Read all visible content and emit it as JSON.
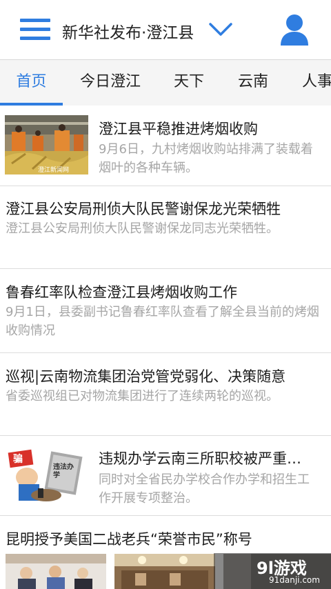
{
  "header": {
    "title": "新华社发布·澄江县",
    "menu_icon": "menu-icon",
    "dropdown_icon": "chevron-down-icon",
    "user_icon": "user-icon",
    "accent_color": "#2f7de0"
  },
  "tabs": [
    {
      "label": "首页",
      "active": true
    },
    {
      "label": "今日澄江",
      "active": false
    },
    {
      "label": "天下",
      "active": false
    },
    {
      "label": "云南",
      "active": false
    },
    {
      "label": "人事",
      "active": false
    }
  ],
  "news": [
    {
      "title": "澄江县平稳推进烤烟收购",
      "summary": "9月6日，九村烤烟收购站排满了装载着烟叶的各种车辆。",
      "thumb_caption": "澄江新闻网"
    },
    {
      "title": "澄江县公安局刑侦大队民警谢保龙光荣牺牲",
      "summary": "澄江县公安局刑侦大队民警谢保龙同志光荣牺牲。"
    },
    {
      "title": "鲁春红率队检查澄江县烤烟收购工作",
      "summary": "9月1日，县委副书记鲁春红率队查看了解全县当前的烤烟收购情况"
    },
    {
      "title": "巡视|云南物流集团治党管党弱化、决策随意",
      "summary": "省委巡视组已对物流集团进行了连续两轮的巡视。"
    },
    {
      "title": "违规办学云南三所职校被严重…",
      "summary": "同时对全省民办学校合作办学和招生工作开展专项整治。",
      "thumb_text_1": "骗",
      "thumb_text_2": "违法办学"
    },
    {
      "title": "昆明授予美国二战老兵“荣誉市民”称号"
    }
  ],
  "watermark": {
    "logo": "9l游戏",
    "url": "91danji.com"
  }
}
